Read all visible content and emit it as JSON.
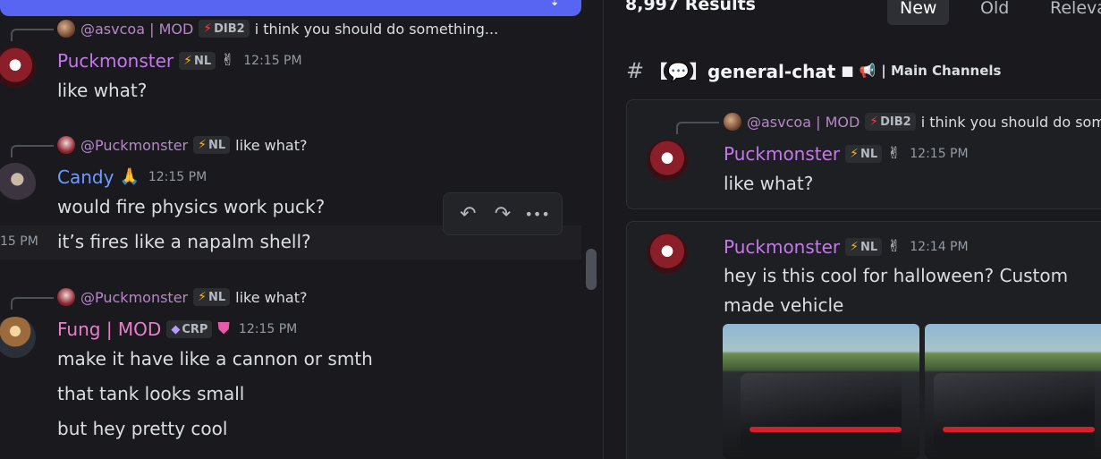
{
  "left_pane": {
    "jump_bar": {
      "label": "",
      "icon": "jump-icon"
    },
    "messages": [
      {
        "reply": {
          "author": "@asvcoa | MOD",
          "tag": "DIB2",
          "text": "i think you should do something..."
        },
        "author": "Puckmonster",
        "tag": "NL",
        "time": "12:15 PM",
        "lines": [
          "like what?"
        ]
      },
      {
        "reply": {
          "author": "@Puckmonster",
          "tag": "NL",
          "text": "like what?"
        },
        "author": "Candy",
        "time": "12:15 PM",
        "lines": [
          "would fire physics work puck?"
        ]
      },
      {
        "side_time": "15 PM",
        "lines": [
          "it’s fires like a napalm shell?"
        ]
      },
      {
        "reply": {
          "author": "@Puckmonster",
          "tag": "NL",
          "text": "like what?"
        },
        "author": "Fung | MOD",
        "tag": "CRP",
        "time": "12:15 PM",
        "lines": [
          "make it have like a cannon or smth",
          "that tank looks small",
          "but hey pretty cool"
        ]
      }
    ],
    "toolbar": {
      "reply_icon": "↶",
      "forward_icon": "↷",
      "more_icon": "•••"
    }
  },
  "right_pane": {
    "results_count": "8,997 Results",
    "sort_tabs": [
      {
        "label": "New",
        "active": true
      },
      {
        "label": "Old",
        "active": false
      },
      {
        "label": "Relevant",
        "active": false
      }
    ],
    "channel": {
      "hash": "#",
      "name": "【💬】general-chat",
      "category": "| Main Channels"
    },
    "results": [
      {
        "reply": {
          "author": "@asvcoa | MOD",
          "tag": "DIB2",
          "text": "i think you should do something..."
        },
        "author": "Puckmonster",
        "tag": "NL",
        "time": "12:15 PM",
        "lines": [
          "like what?"
        ]
      },
      {
        "author": "Puckmonster",
        "tag": "NL",
        "time": "12:14 PM",
        "lines": [
          "hey is this cool for halloween? Custom",
          "made vehicle"
        ]
      }
    ]
  },
  "colors": {
    "accent": "#5865f2",
    "mention_purple": "#c577ee",
    "mod_pink": "#e880c9",
    "candy_blue": "#6f9bff"
  }
}
